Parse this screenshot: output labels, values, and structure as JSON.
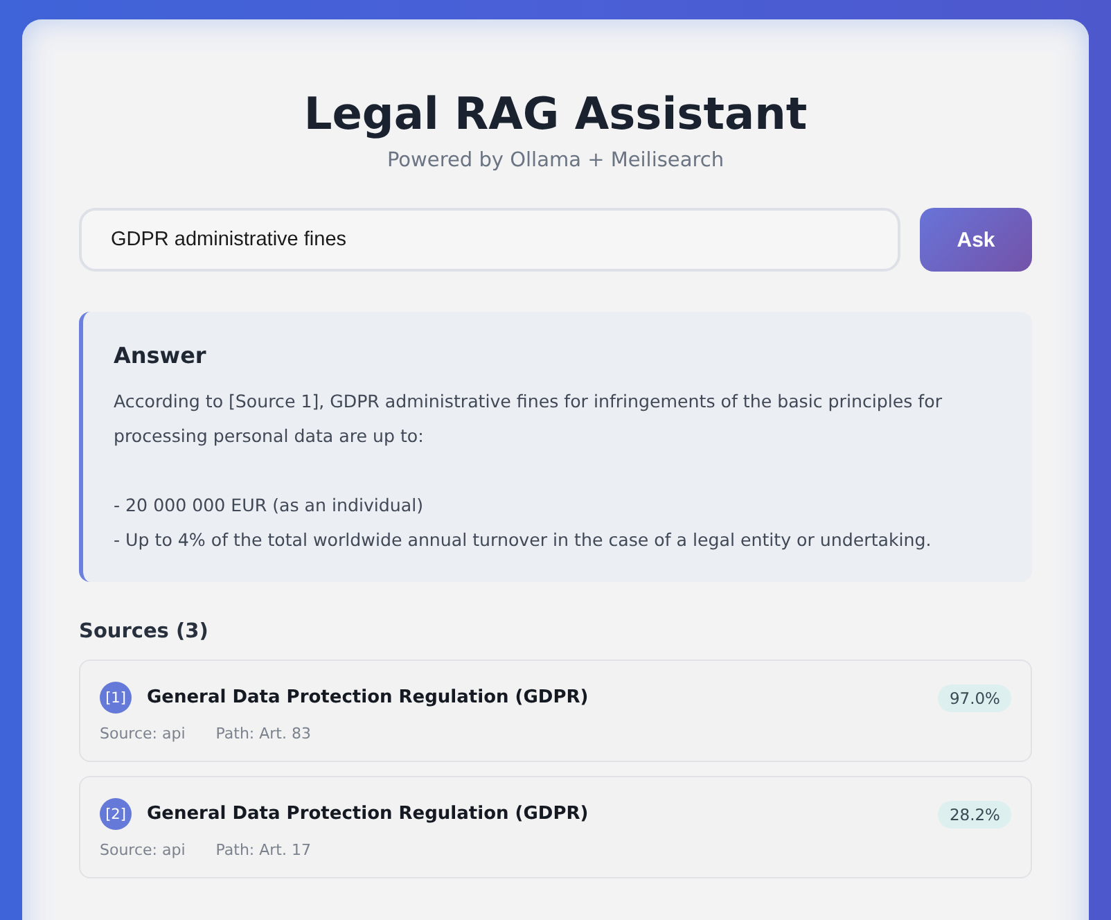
{
  "header": {
    "title": "Legal RAG Assistant",
    "subtitle": "Powered by Ollama + Meilisearch"
  },
  "query": {
    "value": "GDPR administrative fines",
    "button": "Ask"
  },
  "answer": {
    "heading": "Answer",
    "intro": "According to [Source 1], GDPR administrative fines for infringements of the basic principles for processing personal data are up to:",
    "points": [
      "- 20 000 000 EUR (as an individual)",
      "- Up to 4% of the total worldwide annual turnover in the case of a legal entity or undertaking."
    ]
  },
  "sources": {
    "heading": "Sources (3)",
    "items": [
      {
        "index": "[1]",
        "title": "General Data Protection Regulation (GDPR)",
        "score": "97.0%",
        "source": "Source: api",
        "path": "Path: Art. 83"
      },
      {
        "index": "[2]",
        "title": "General Data Protection Regulation (GDPR)",
        "score": "28.2%",
        "source": "Source: api",
        "path": "Path: Art. 17"
      }
    ]
  }
}
